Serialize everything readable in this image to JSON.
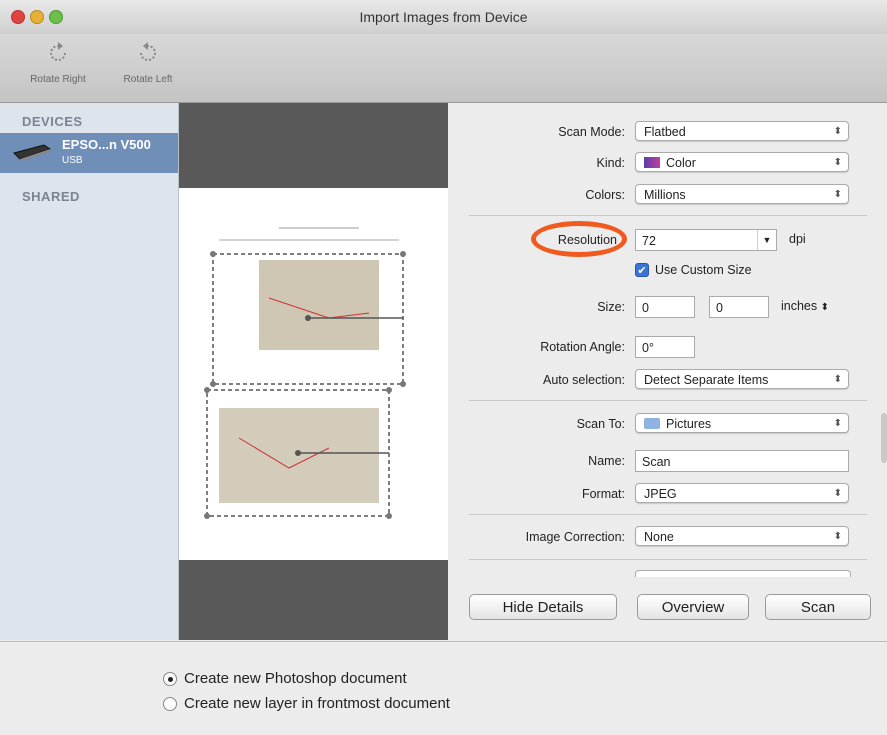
{
  "window": {
    "title": "Import Images from Device"
  },
  "toolbar": {
    "rotate_right": "Rotate Right",
    "rotate_left": "Rotate Left"
  },
  "sidebar": {
    "devices_header": "DEVICES",
    "device_name": "EPSO...n V500",
    "device_sub": "USB",
    "shared_header": "SHARED"
  },
  "details": {
    "scan_mode": {
      "label": "Scan Mode:",
      "value": "Flatbed"
    },
    "kind": {
      "label": "Kind:",
      "value": "Color"
    },
    "colors": {
      "label": "Colors:",
      "value": "Millions"
    },
    "resolution": {
      "label": "Resolution",
      "value": "72",
      "unit": "dpi"
    },
    "use_custom_size": {
      "label": "Use Custom Size",
      "checked": true
    },
    "size": {
      "label": "Size:",
      "width": "0",
      "height": "0",
      "unit": "inches"
    },
    "rotation": {
      "label": "Rotation Angle:",
      "value": "0°"
    },
    "auto_selection": {
      "label": "Auto selection:",
      "value": "Detect Separate Items"
    },
    "scan_to": {
      "label": "Scan To:",
      "value": "Pictures"
    },
    "name": {
      "label": "Name:",
      "value": "Scan"
    },
    "format": {
      "label": "Format:",
      "value": "JPEG"
    },
    "image_correction": {
      "label": "Image Correction:",
      "value": "None"
    }
  },
  "buttons": {
    "hide_details": "Hide Details",
    "overview": "Overview",
    "scan": "Scan"
  },
  "bottom": {
    "option1": "Create new Photoshop document",
    "option2": "Create new layer in frontmost document",
    "selected": 1
  },
  "colors": {
    "highlight_ring": "#f05a1e",
    "device_selected": "#6f8fb8",
    "sidebar_bg": "#dde4ec"
  }
}
